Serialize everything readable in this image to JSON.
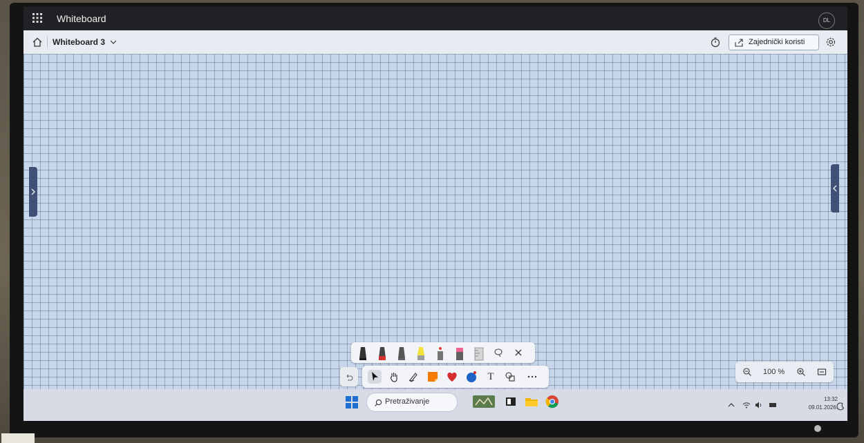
{
  "app": {
    "title": "Whiteboard",
    "user_initials": "DL"
  },
  "toolbar": {
    "board_name": "Whiteboard 3",
    "share_label": "Zajednički koristi"
  },
  "pen_tray": {
    "pens": [
      {
        "name": "black-pen",
        "color": "#1a1a1a"
      },
      {
        "name": "red-pen",
        "color": "#d32f2f"
      },
      {
        "name": "gray-pen",
        "color": "#5f6368"
      },
      {
        "name": "yellow-highlighter",
        "color": "#f4e23a"
      },
      {
        "name": "red-laser-pen",
        "color": "#e53935"
      },
      {
        "name": "pink-eraser",
        "color": "#f06292"
      },
      {
        "name": "ruler",
        "color": "#bdbdbd"
      }
    ]
  },
  "zoom": {
    "value": "100 %"
  },
  "taskbar": {
    "search_placeholder": "Pretraživanje",
    "time": "13:32",
    "date": "09.01.2026."
  }
}
